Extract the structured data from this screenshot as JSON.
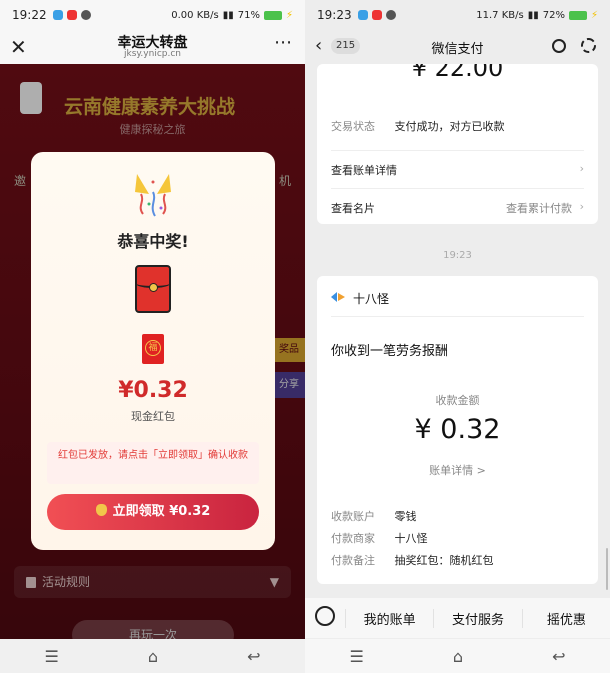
{
  "left": {
    "status": {
      "time": "19:22",
      "net": "0.00 KB/s",
      "battery": "71%"
    },
    "header": {
      "title": "幸运大转盘",
      "domain": "jksy.ynicp.cn"
    },
    "game": {
      "title": "云南健康素养大挑战",
      "subtitle": "健康探秘之旅",
      "side_left": "邀",
      "side_right": "机",
      "tag_gold": "奖品",
      "tag_share": "分享",
      "rules_label": "活动规则",
      "again_label": "再玩一次"
    },
    "modal": {
      "congrats": "恭喜中奖!",
      "envelope_char": "福",
      "amount": "¥0.32",
      "prize_type": "现金红包",
      "notice": "红包已发放，请点击「立即领取」确认收款",
      "claim_label": "立即领取 ¥0.32"
    }
  },
  "right": {
    "status": {
      "time": "19:23",
      "net": "11.7 KB/s",
      "battery": "72%"
    },
    "header": {
      "unread": "215",
      "title": "微信支付"
    },
    "top_card": {
      "amount": "¥ 22.00",
      "status_key": "交易状态",
      "status_value": "支付成功，对方已收款",
      "bill_detail": "查看账单详情",
      "card_label": "查看名片",
      "cumulative": "查看累计付款"
    },
    "time_sep": "19:23",
    "receipt": {
      "sender": "十八怪",
      "message": "你收到一笔劳务报酬",
      "amount_label": "收款金额",
      "amount": "¥ 0.32",
      "bill_link": "账单详情 >",
      "rows": [
        {
          "k": "收款账户",
          "v": "零钱"
        },
        {
          "k": "付款商家",
          "v": "十八怪"
        },
        {
          "k": "付款备注",
          "v": "抽奖红包：随机红包"
        }
      ]
    },
    "menu": [
      "我的账单",
      "支付服务",
      "摇优惠"
    ]
  },
  "colors": {
    "accent_red": "#d02a2a",
    "game_bg": "#5a0a12",
    "gold": "#c9a23a"
  }
}
